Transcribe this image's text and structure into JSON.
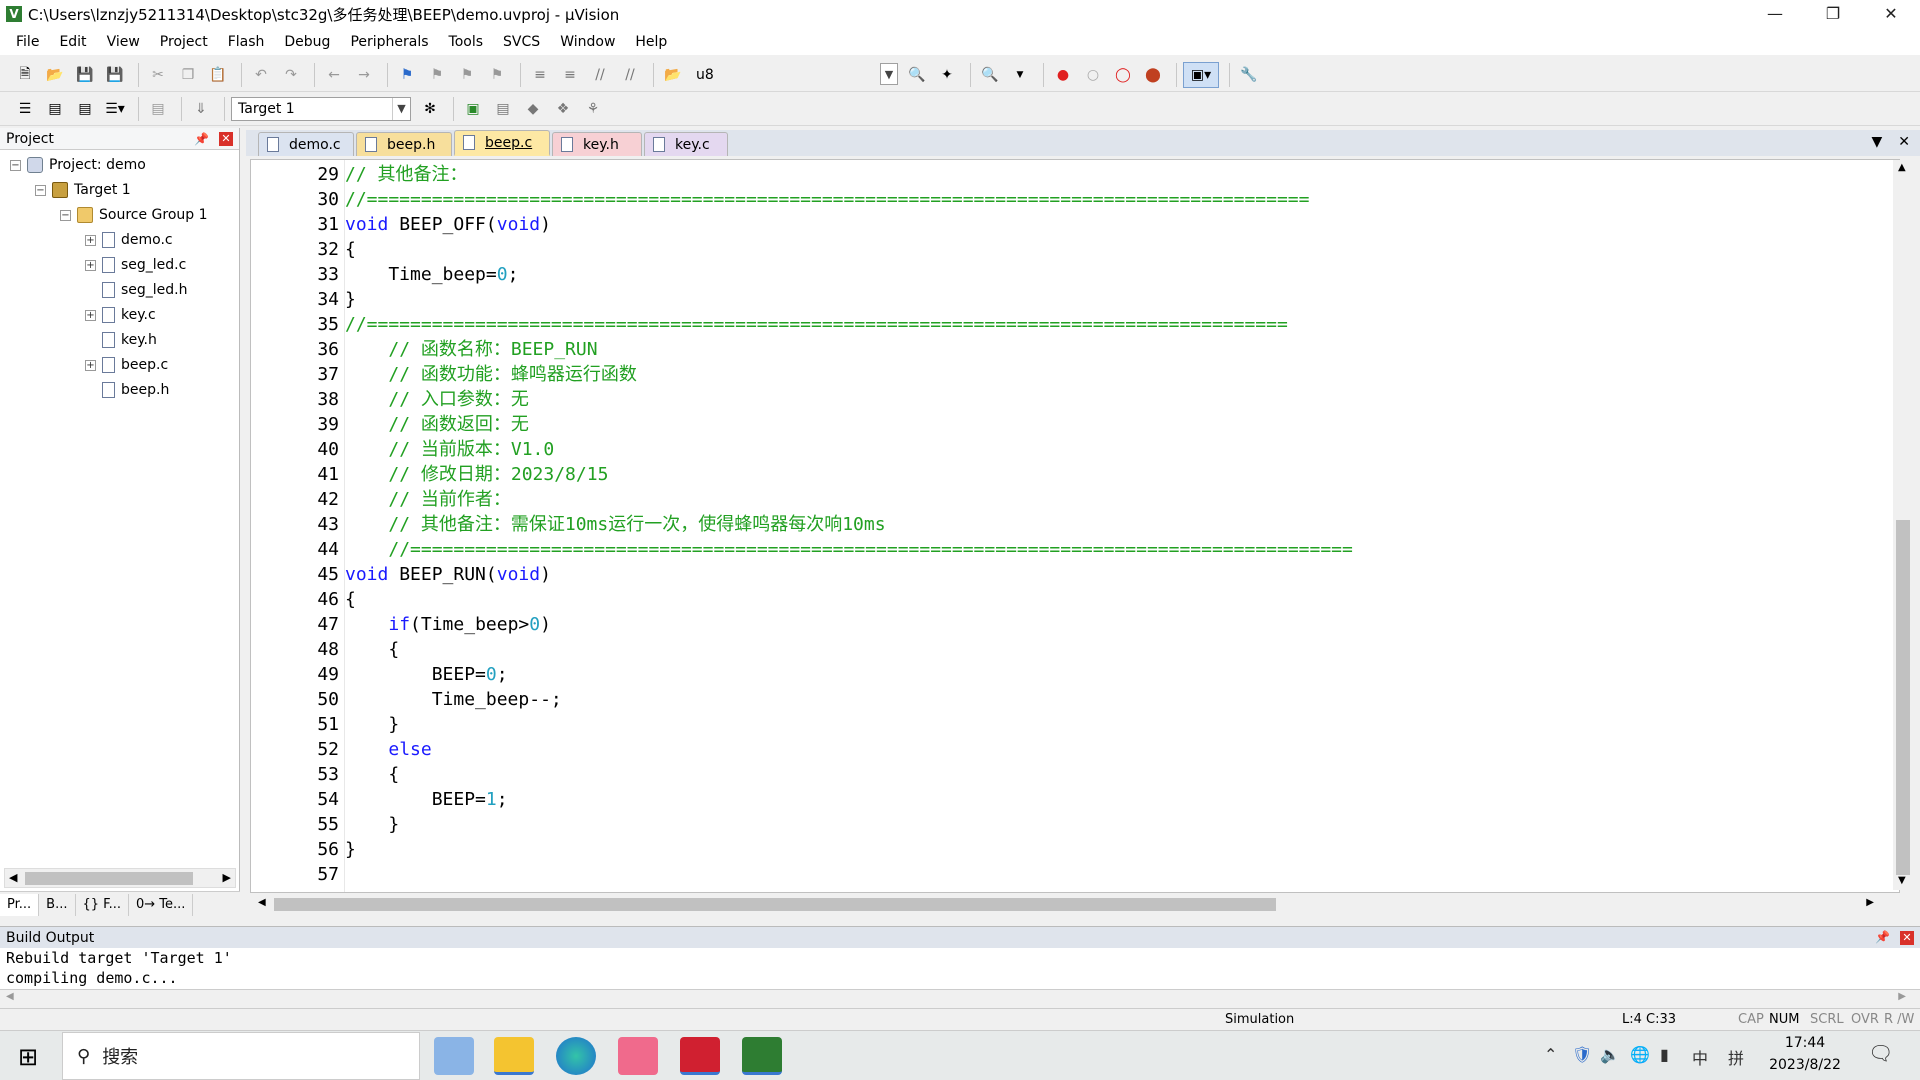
{
  "window": {
    "title": "C:\\Users\\lznzjy5211314\\Desktop\\stc32g\\多任务处理\\BEEP\\demo.uvproj - µVision"
  },
  "menu": [
    "File",
    "Edit",
    "View",
    "Project",
    "Flash",
    "Debug",
    "Peripherals",
    "Tools",
    "SVCS",
    "Window",
    "Help"
  ],
  "toolbar1": {
    "find_value": "u8"
  },
  "toolbar2": {
    "target_value": "Target 1"
  },
  "project_panel": {
    "title": "Project",
    "tree": [
      {
        "label": "Project: demo"
      },
      {
        "label": "Target 1"
      },
      {
        "label": "Source Group 1"
      },
      {
        "label": "demo.c"
      },
      {
        "label": "seg_led.c"
      },
      {
        "label": "seg_led.h"
      },
      {
        "label": "key.c"
      },
      {
        "label": "key.h"
      },
      {
        "label": "beep.c"
      },
      {
        "label": "beep.h"
      }
    ],
    "bottom_tabs": [
      "Pr...",
      "B...",
      "{} F...",
      "0→ Te..."
    ]
  },
  "editor_tabs": [
    {
      "label": "demo.c",
      "color": "#dbe3f0"
    },
    {
      "label": "beep.h",
      "color": "#f7df9c"
    },
    {
      "label": "beep.c",
      "color": "#fde8a4",
      "active": true
    },
    {
      "label": "key.h",
      "color": "#f7d0d4"
    },
    {
      "label": "key.c",
      "color": "#e4d8f0"
    }
  ],
  "code_lines": [
    {
      "n": "29",
      "t": "// 其他备注："
    },
    {
      "n": "30",
      "t": "//======================================================================================="
    },
    {
      "n": "31",
      "t": "void BEEP_OFF(void)"
    },
    {
      "n": "32",
      "t": "{"
    },
    {
      "n": "33",
      "t": "    Time_beep=0;"
    },
    {
      "n": "34",
      "t": "}"
    },
    {
      "n": "35",
      "t": "//====================================================================================="
    },
    {
      "n": "36",
      "t": "    // 函数名称：BEEP_RUN"
    },
    {
      "n": "37",
      "t": "    // 函数功能：蜂鸣器运行函数"
    },
    {
      "n": "38",
      "t": "    // 入口参数：无"
    },
    {
      "n": "39",
      "t": "    // 函数返回：无"
    },
    {
      "n": "40",
      "t": "    // 当前版本：V1.0"
    },
    {
      "n": "41",
      "t": "    // 修改日期：2023/8/15"
    },
    {
      "n": "42",
      "t": "    // 当前作者："
    },
    {
      "n": "43",
      "t": "    // 其他备注：需保证10ms运行一次，使得蜂鸣器每次响10ms"
    },
    {
      "n": "44",
      "t": "    //======================================================================================="
    },
    {
      "n": "45",
      "t": "void BEEP_RUN(void)"
    },
    {
      "n": "46",
      "t": "{"
    },
    {
      "n": "47",
      "t": "    if(Time_beep>0)"
    },
    {
      "n": "48",
      "t": "    {"
    },
    {
      "n": "49",
      "t": "        BEEP=0;"
    },
    {
      "n": "50",
      "t": "        Time_beep--;"
    },
    {
      "n": "51",
      "t": "    }"
    },
    {
      "n": "52",
      "t": "    else"
    },
    {
      "n": "53",
      "t": "    {"
    },
    {
      "n": "54",
      "t": "        BEEP=1;"
    },
    {
      "n": "55",
      "t": "    }"
    },
    {
      "n": "56",
      "t": "}"
    },
    {
      "n": "57",
      "t": ""
    }
  ],
  "build_output": {
    "title": "Build Output",
    "lines": [
      "Rebuild target 'Target 1'",
      "compiling demo.c..."
    ]
  },
  "status": {
    "mode": "Simulation",
    "cursor": "L:4 C:33",
    "indicators": [
      "CAP",
      "NUM",
      "SCRL",
      "OVR",
      "R /W"
    ]
  },
  "taskbar": {
    "search_placeholder": "搜索",
    "time": "17:44",
    "date": "2023/8/22",
    "ime1": "中",
    "ime2": "拼"
  }
}
